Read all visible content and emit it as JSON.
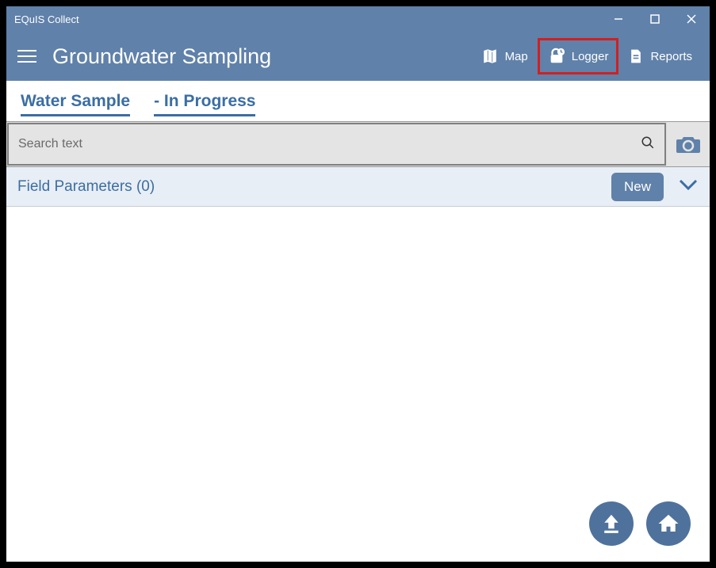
{
  "window": {
    "title": "EQuIS Collect"
  },
  "header": {
    "page_title": "Groundwater Sampling",
    "actions": {
      "map": "Map",
      "logger": "Logger",
      "reports": "Reports"
    }
  },
  "tabs": {
    "water_sample": "Water Sample",
    "in_progress": " - In Progress"
  },
  "search": {
    "placeholder": "Search text"
  },
  "section": {
    "title": "Field Parameters (0)",
    "new_label": "New"
  }
}
